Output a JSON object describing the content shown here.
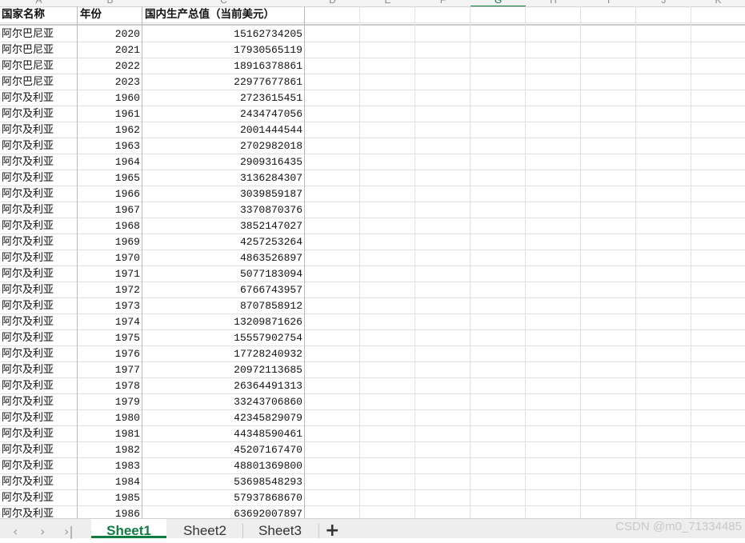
{
  "column_letters": [
    "A",
    "B",
    "C",
    "D",
    "E",
    "F",
    "G",
    "H",
    "I",
    "J",
    "K"
  ],
  "selected_column": "G",
  "header_row": {
    "country": "国家名称",
    "year": "年份",
    "gdp": "国内生产总值（当前美元）"
  },
  "rows": [
    {
      "country": "阿尔巴尼亚",
      "year": "2020",
      "gdp": "15162734205"
    },
    {
      "country": "阿尔巴尼亚",
      "year": "2021",
      "gdp": "17930565119"
    },
    {
      "country": "阿尔巴尼亚",
      "year": "2022",
      "gdp": "18916378861"
    },
    {
      "country": "阿尔巴尼亚",
      "year": "2023",
      "gdp": "22977677861"
    },
    {
      "country": "阿尔及利亚",
      "year": "1960",
      "gdp": "2723615451"
    },
    {
      "country": "阿尔及利亚",
      "year": "1961",
      "gdp": "2434747056"
    },
    {
      "country": "阿尔及利亚",
      "year": "1962",
      "gdp": "2001444544"
    },
    {
      "country": "阿尔及利亚",
      "year": "1963",
      "gdp": "2702982018"
    },
    {
      "country": "阿尔及利亚",
      "year": "1964",
      "gdp": "2909316435"
    },
    {
      "country": "阿尔及利亚",
      "year": "1965",
      "gdp": "3136284307"
    },
    {
      "country": "阿尔及利亚",
      "year": "1966",
      "gdp": "3039859187"
    },
    {
      "country": "阿尔及利亚",
      "year": "1967",
      "gdp": "3370870376"
    },
    {
      "country": "阿尔及利亚",
      "year": "1968",
      "gdp": "3852147027"
    },
    {
      "country": "阿尔及利亚",
      "year": "1969",
      "gdp": "4257253264"
    },
    {
      "country": "阿尔及利亚",
      "year": "1970",
      "gdp": "4863526897"
    },
    {
      "country": "阿尔及利亚",
      "year": "1971",
      "gdp": "5077183094"
    },
    {
      "country": "阿尔及利亚",
      "year": "1972",
      "gdp": "6766743957"
    },
    {
      "country": "阿尔及利亚",
      "year": "1973",
      "gdp": "8707858912"
    },
    {
      "country": "阿尔及利亚",
      "year": "1974",
      "gdp": "13209871626"
    },
    {
      "country": "阿尔及利亚",
      "year": "1975",
      "gdp": "15557902754"
    },
    {
      "country": "阿尔及利亚",
      "year": "1976",
      "gdp": "17728240932"
    },
    {
      "country": "阿尔及利亚",
      "year": "1977",
      "gdp": "20972113685"
    },
    {
      "country": "阿尔及利亚",
      "year": "1978",
      "gdp": "26364491313"
    },
    {
      "country": "阿尔及利亚",
      "year": "1979",
      "gdp": "33243706860"
    },
    {
      "country": "阿尔及利亚",
      "year": "1980",
      "gdp": "42345829079"
    },
    {
      "country": "阿尔及利亚",
      "year": "1981",
      "gdp": "44348590461"
    },
    {
      "country": "阿尔及利亚",
      "year": "1982",
      "gdp": "45207167470"
    },
    {
      "country": "阿尔及利亚",
      "year": "1983",
      "gdp": "48801369800"
    },
    {
      "country": "阿尔及利亚",
      "year": "1984",
      "gdp": "53698548293"
    },
    {
      "country": "阿尔及利亚",
      "year": "1985",
      "gdp": "57937868670"
    },
    {
      "country": "阿尔及利亚",
      "year": "1986",
      "gdp": "63692007897"
    }
  ],
  "sheet_tabs": [
    {
      "label": "Sheet1",
      "active": true
    },
    {
      "label": "Sheet2",
      "active": false
    },
    {
      "label": "Sheet3",
      "active": false
    }
  ],
  "nav_icons": [
    "prev-sheet-icon",
    "next-sheet-icon",
    "last-sheet-icon"
  ],
  "add_sheet_symbol": "+",
  "watermark": "CSDN @m0_71334485",
  "accent_color": "#107c41"
}
